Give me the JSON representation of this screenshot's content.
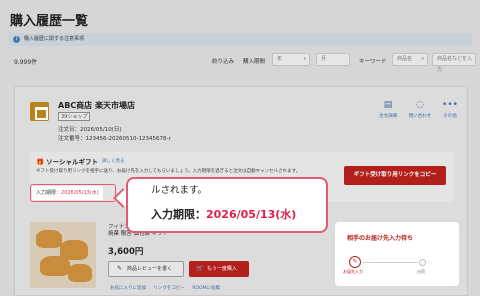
{
  "page": {
    "title": "購入履歴一覧",
    "notice": "購入履歴に関する注意事項",
    "count": "9,999件"
  },
  "filters": {
    "label": "絞り込み",
    "period_label": "購入期間",
    "year_value": "年",
    "month_value": "月",
    "keyword_label": "キーワード",
    "keyword_type": "商品名",
    "keyword_placeholder": "商品名などを入力"
  },
  "order": {
    "shop_name": "ABC商店 楽天市場店",
    "shop_tag": "39ショップ",
    "order_date": "注文日：2026/05/10(日)",
    "order_number": "注文番号：123456-20260510-12345678-r",
    "actions": [
      {
        "label": "注文詳細",
        "icon": "document-icon"
      },
      {
        "label": "問い合わせ",
        "icon": "chat-icon"
      },
      {
        "label": "その他",
        "icon": "more-icon"
      }
    ]
  },
  "gift": {
    "title": "ソーシャルギフト",
    "more_link": "詳しく見る",
    "description": "ギフト受け取り用リンクを相手に送り、お届け先を入力してもらいましょう。入力期限を過ぎると注文は自動キャンセルされます。",
    "deadline_label": "入力期限：",
    "deadline_value": "2026/05/13(水)",
    "copy_button": "ギフト受け取り用リンクをコピー"
  },
  "callout": {
    "top_text": "ルされます。",
    "main_label": "入力期限：",
    "main_value": "2026/05/13(水)"
  },
  "product": {
    "name": "フィナンシェ\n焼菓 贈答 個包装 ギフト",
    "price": "3,600円",
    "review_button": "商品レビューを書く",
    "rebuy_button": "もう一度購入",
    "links": [
      "お気に入りに追加",
      "リンクをコピー",
      "ROOMに投稿"
    ]
  },
  "status": {
    "title": "相手のお届け先入力待ち",
    "step1": "お届先入力",
    "step2": "出荷",
    "progress": 0
  },
  "colors": {
    "accent_red": "#b3201c",
    "highlight_pink": "#e35b73",
    "date_red": "#e11d48",
    "link_blue": "#3b6aa3"
  }
}
